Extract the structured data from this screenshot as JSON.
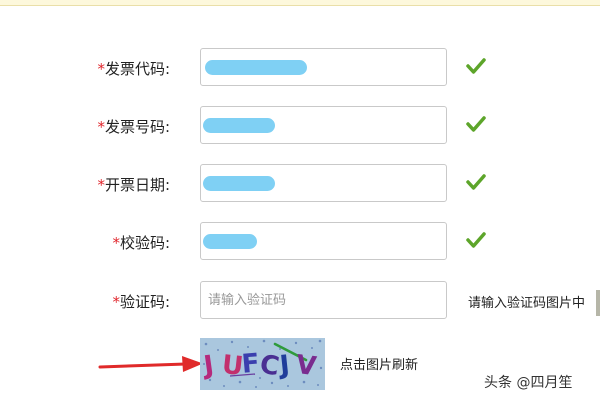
{
  "form": {
    "required_mark": "*",
    "fields": [
      {
        "label": "发票代码:",
        "status": "valid"
      },
      {
        "label": "发票号码:",
        "status": "valid"
      },
      {
        "label": "开票日期:",
        "status": "valid"
      },
      {
        "label": "校验码:",
        "status": "valid"
      },
      {
        "label": "验证码:",
        "placeholder": "请输入验证码",
        "hint": "请输入验证码图片中"
      }
    ],
    "captcha": {
      "code": "JUFCJV",
      "refresh_label": "点击图片刷新"
    }
  },
  "watermark": "头条 @四月笙",
  "colors": {
    "required": "#e0262c",
    "valid_check": "#5da52a",
    "redaction": "#7fd0f4",
    "arrow": "#e02a2a"
  }
}
